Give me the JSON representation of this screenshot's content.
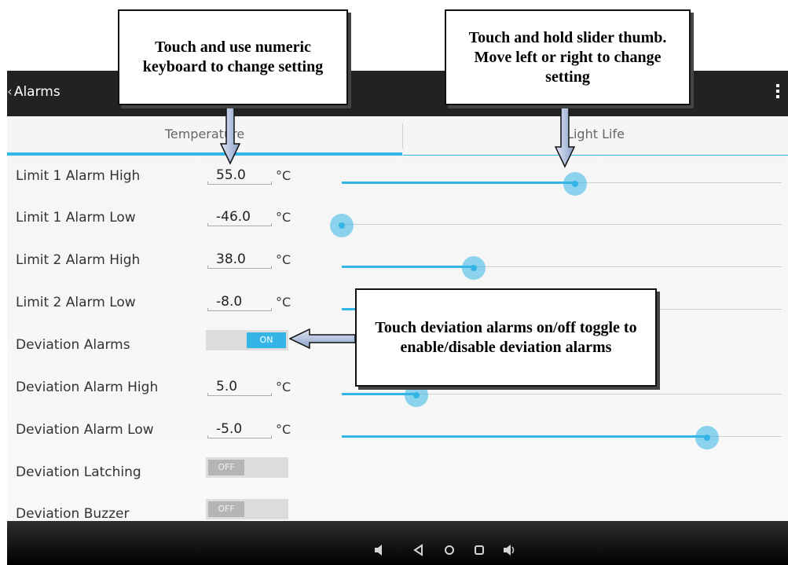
{
  "action_bar": {
    "back_label": "Alarms",
    "back_icon": "chevron-left-icon",
    "menu_icon": "overflow-menu-icon"
  },
  "tabs": [
    {
      "label": "Temperature",
      "selected": true
    },
    {
      "label": "Light Life",
      "selected": false
    }
  ],
  "accent_color": "#33b5e5",
  "rows": [
    {
      "label": "Limit 1 Alarm High",
      "value": "55.0",
      "unit": "°C",
      "slider_fraction": 0.53
    },
    {
      "label": "Limit 1 Alarm Low",
      "value": "-46.0",
      "unit": "°C",
      "slider_fraction": 0.0
    },
    {
      "label": "Limit 2 Alarm High",
      "value": "38.0",
      "unit": "°C",
      "slider_fraction": 0.3
    },
    {
      "label": "Limit 2 Alarm Low",
      "value": "-8.0",
      "unit": "°C",
      "slider_fraction": 0.46
    },
    {
      "label": "Deviation Alarms",
      "toggle": "ON"
    },
    {
      "label": "Deviation Alarm High",
      "value": "5.0",
      "unit": "°C",
      "slider_fraction": 0.17
    },
    {
      "label": "Deviation Alarm Low",
      "value": "-5.0",
      "unit": "°C",
      "slider_fraction": 0.83
    },
    {
      "label": "Deviation Latching",
      "toggle": "OFF"
    },
    {
      "label": "Deviation Buzzer",
      "toggle": "OFF"
    }
  ],
  "callouts": {
    "numeric": "Touch and use numeric keyboard to change setting",
    "slider": "Touch and hold slider thumb.  Move left or right to change setting",
    "deviation": "Touch deviation alarms on/off toggle to enable/disable deviation alarms"
  },
  "nav_icons": [
    "volume-down-icon",
    "back-icon",
    "home-icon",
    "recents-icon",
    "volume-up-icon"
  ]
}
